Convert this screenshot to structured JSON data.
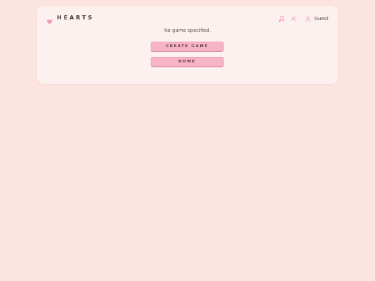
{
  "app": {
    "title": "HEARTS",
    "icons": {
      "brand": "heart-icon",
      "music": "music-note-icon",
      "theme": "sun-icon",
      "user": "user-icon"
    },
    "colors": {
      "accent": "#f7b3c8",
      "heart": "#f09ab4",
      "background": "#fce4e1",
      "card": "#fdf1f0"
    }
  },
  "header": {
    "user_name": "Guest"
  },
  "main": {
    "message": "No game specified.",
    "create_label": "CREATE GAME",
    "home_label": "HOME"
  }
}
